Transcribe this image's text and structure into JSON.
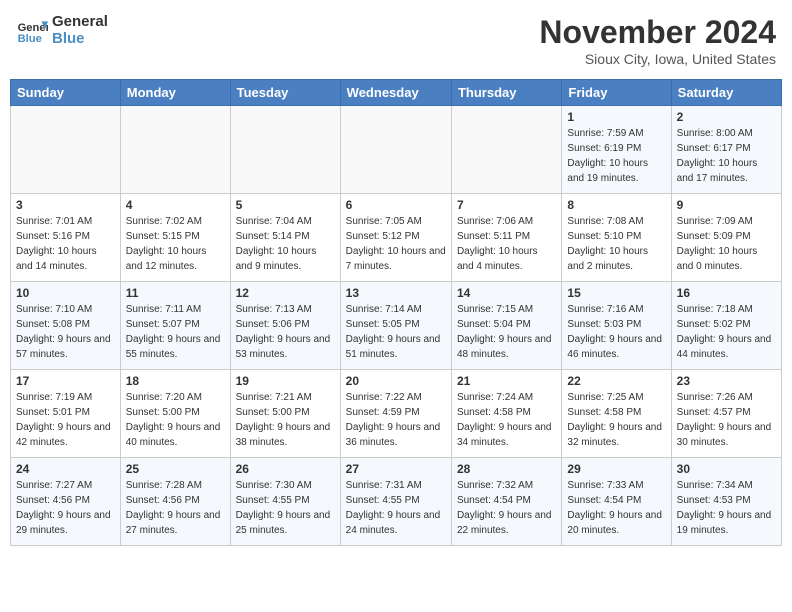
{
  "header": {
    "logo_line1": "General",
    "logo_line2": "Blue",
    "month": "November 2024",
    "location": "Sioux City, Iowa, United States"
  },
  "days_of_week": [
    "Sunday",
    "Monday",
    "Tuesday",
    "Wednesday",
    "Thursday",
    "Friday",
    "Saturday"
  ],
  "weeks": [
    [
      {
        "day": "",
        "info": ""
      },
      {
        "day": "",
        "info": ""
      },
      {
        "day": "",
        "info": ""
      },
      {
        "day": "",
        "info": ""
      },
      {
        "day": "",
        "info": ""
      },
      {
        "day": "1",
        "info": "Sunrise: 7:59 AM\nSunset: 6:19 PM\nDaylight: 10 hours and 19 minutes."
      },
      {
        "day": "2",
        "info": "Sunrise: 8:00 AM\nSunset: 6:17 PM\nDaylight: 10 hours and 17 minutes."
      }
    ],
    [
      {
        "day": "3",
        "info": "Sunrise: 7:01 AM\nSunset: 5:16 PM\nDaylight: 10 hours and 14 minutes."
      },
      {
        "day": "4",
        "info": "Sunrise: 7:02 AM\nSunset: 5:15 PM\nDaylight: 10 hours and 12 minutes."
      },
      {
        "day": "5",
        "info": "Sunrise: 7:04 AM\nSunset: 5:14 PM\nDaylight: 10 hours and 9 minutes."
      },
      {
        "day": "6",
        "info": "Sunrise: 7:05 AM\nSunset: 5:12 PM\nDaylight: 10 hours and 7 minutes."
      },
      {
        "day": "7",
        "info": "Sunrise: 7:06 AM\nSunset: 5:11 PM\nDaylight: 10 hours and 4 minutes."
      },
      {
        "day": "8",
        "info": "Sunrise: 7:08 AM\nSunset: 5:10 PM\nDaylight: 10 hours and 2 minutes."
      },
      {
        "day": "9",
        "info": "Sunrise: 7:09 AM\nSunset: 5:09 PM\nDaylight: 10 hours and 0 minutes."
      }
    ],
    [
      {
        "day": "10",
        "info": "Sunrise: 7:10 AM\nSunset: 5:08 PM\nDaylight: 9 hours and 57 minutes."
      },
      {
        "day": "11",
        "info": "Sunrise: 7:11 AM\nSunset: 5:07 PM\nDaylight: 9 hours and 55 minutes."
      },
      {
        "day": "12",
        "info": "Sunrise: 7:13 AM\nSunset: 5:06 PM\nDaylight: 9 hours and 53 minutes."
      },
      {
        "day": "13",
        "info": "Sunrise: 7:14 AM\nSunset: 5:05 PM\nDaylight: 9 hours and 51 minutes."
      },
      {
        "day": "14",
        "info": "Sunrise: 7:15 AM\nSunset: 5:04 PM\nDaylight: 9 hours and 48 minutes."
      },
      {
        "day": "15",
        "info": "Sunrise: 7:16 AM\nSunset: 5:03 PM\nDaylight: 9 hours and 46 minutes."
      },
      {
        "day": "16",
        "info": "Sunrise: 7:18 AM\nSunset: 5:02 PM\nDaylight: 9 hours and 44 minutes."
      }
    ],
    [
      {
        "day": "17",
        "info": "Sunrise: 7:19 AM\nSunset: 5:01 PM\nDaylight: 9 hours and 42 minutes."
      },
      {
        "day": "18",
        "info": "Sunrise: 7:20 AM\nSunset: 5:00 PM\nDaylight: 9 hours and 40 minutes."
      },
      {
        "day": "19",
        "info": "Sunrise: 7:21 AM\nSunset: 5:00 PM\nDaylight: 9 hours and 38 minutes."
      },
      {
        "day": "20",
        "info": "Sunrise: 7:22 AM\nSunset: 4:59 PM\nDaylight: 9 hours and 36 minutes."
      },
      {
        "day": "21",
        "info": "Sunrise: 7:24 AM\nSunset: 4:58 PM\nDaylight: 9 hours and 34 minutes."
      },
      {
        "day": "22",
        "info": "Sunrise: 7:25 AM\nSunset: 4:58 PM\nDaylight: 9 hours and 32 minutes."
      },
      {
        "day": "23",
        "info": "Sunrise: 7:26 AM\nSunset: 4:57 PM\nDaylight: 9 hours and 30 minutes."
      }
    ],
    [
      {
        "day": "24",
        "info": "Sunrise: 7:27 AM\nSunset: 4:56 PM\nDaylight: 9 hours and 29 minutes."
      },
      {
        "day": "25",
        "info": "Sunrise: 7:28 AM\nSunset: 4:56 PM\nDaylight: 9 hours and 27 minutes."
      },
      {
        "day": "26",
        "info": "Sunrise: 7:30 AM\nSunset: 4:55 PM\nDaylight: 9 hours and 25 minutes."
      },
      {
        "day": "27",
        "info": "Sunrise: 7:31 AM\nSunset: 4:55 PM\nDaylight: 9 hours and 24 minutes."
      },
      {
        "day": "28",
        "info": "Sunrise: 7:32 AM\nSunset: 4:54 PM\nDaylight: 9 hours and 22 minutes."
      },
      {
        "day": "29",
        "info": "Sunrise: 7:33 AM\nSunset: 4:54 PM\nDaylight: 9 hours and 20 minutes."
      },
      {
        "day": "30",
        "info": "Sunrise: 7:34 AM\nSunset: 4:53 PM\nDaylight: 9 hours and 19 minutes."
      }
    ]
  ]
}
